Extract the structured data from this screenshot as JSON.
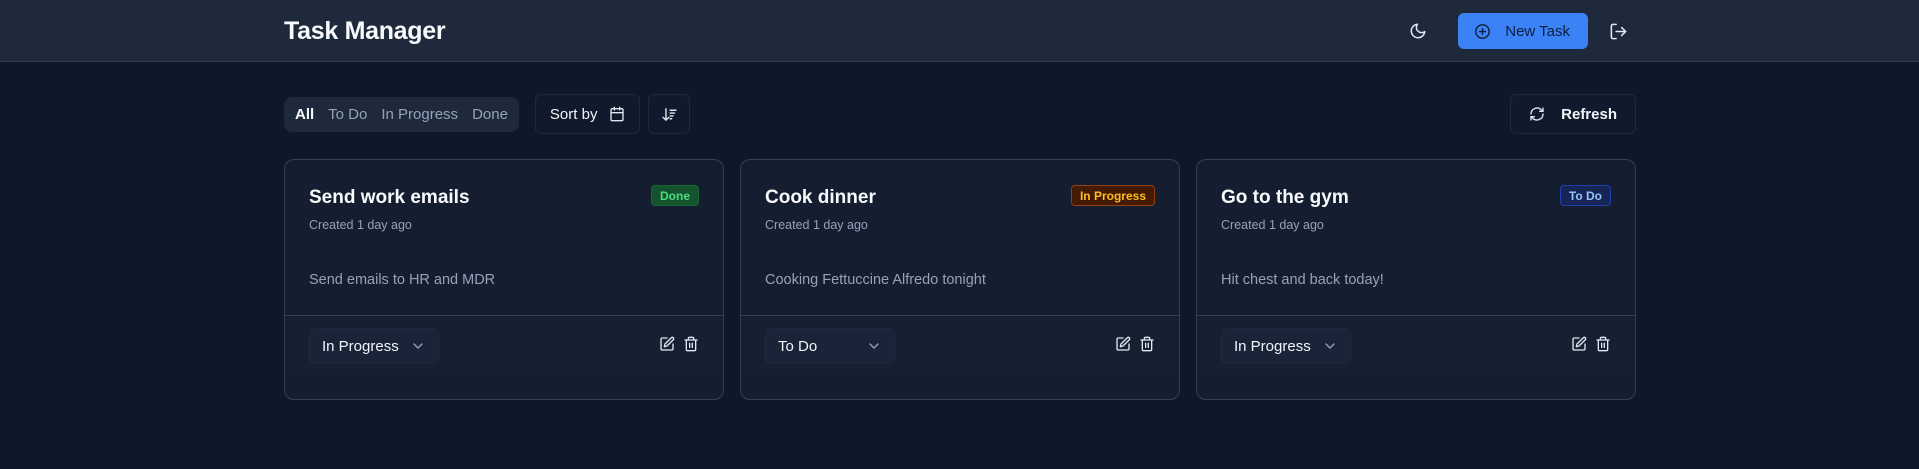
{
  "header": {
    "title": "Task Manager",
    "new_task_label": "New Task",
    "theme_icon": "moon-icon",
    "logout_icon": "logout-icon",
    "accent_color": "#3b82f6"
  },
  "toolbar": {
    "filters": [
      "All",
      "To Do",
      "In Progress",
      "Done"
    ],
    "active_filter": "All",
    "sort_label": "Sort by",
    "refresh_label": "Refresh"
  },
  "tasks": [
    {
      "title": "Send work emails",
      "created": "Created 1 day ago",
      "description": "Send emails to HR and MDR",
      "badge": "Done",
      "status": "In Progress"
    },
    {
      "title": "Cook dinner",
      "created": "Created 1 day ago",
      "description": "Cooking Fettuccine Alfredo tonight",
      "badge": "In Progress",
      "status": "To Do"
    },
    {
      "title": "Go to the gym",
      "created": "Created 1 day ago",
      "description": "Hit chest and back today!",
      "badge": "To Do",
      "status": "In Progress"
    }
  ]
}
